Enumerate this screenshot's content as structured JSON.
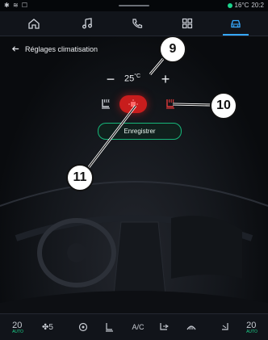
{
  "status_bar": {
    "left_icons": [
      "bluetooth-icon",
      "wifi-icon",
      "phone-icon"
    ],
    "temperature": "16°C",
    "time": "20:2"
  },
  "nav": {
    "items": [
      {
        "id": "home",
        "icon": "home-icon"
      },
      {
        "id": "music",
        "icon": "music-note-icon"
      },
      {
        "id": "phone",
        "icon": "phone-icon"
      },
      {
        "id": "apps",
        "icon": "apps-grid-icon"
      },
      {
        "id": "vehicle",
        "icon": "car-icon",
        "active": true
      }
    ]
  },
  "page": {
    "title": "Réglages climatisation"
  },
  "temperature": {
    "value": "25",
    "unit": "°C",
    "minus_label": "−",
    "plus_label": "+"
  },
  "controls": {
    "save_label": "Enregistrer"
  },
  "callouts": {
    "c9": "9",
    "c10": "10",
    "c11": "11"
  },
  "bottom_bar": {
    "left_temp": "20",
    "left_temp_unit": "AUTO",
    "fan_speed": "5",
    "ac_label": "A/C",
    "right_temp": "20",
    "right_temp_unit": "AUTO"
  },
  "colors": {
    "accent_blue": "#36a8ff",
    "active_red": "#c81d1d",
    "seat_heat_red": "#e03a3a",
    "save_green": "#17b77a"
  }
}
